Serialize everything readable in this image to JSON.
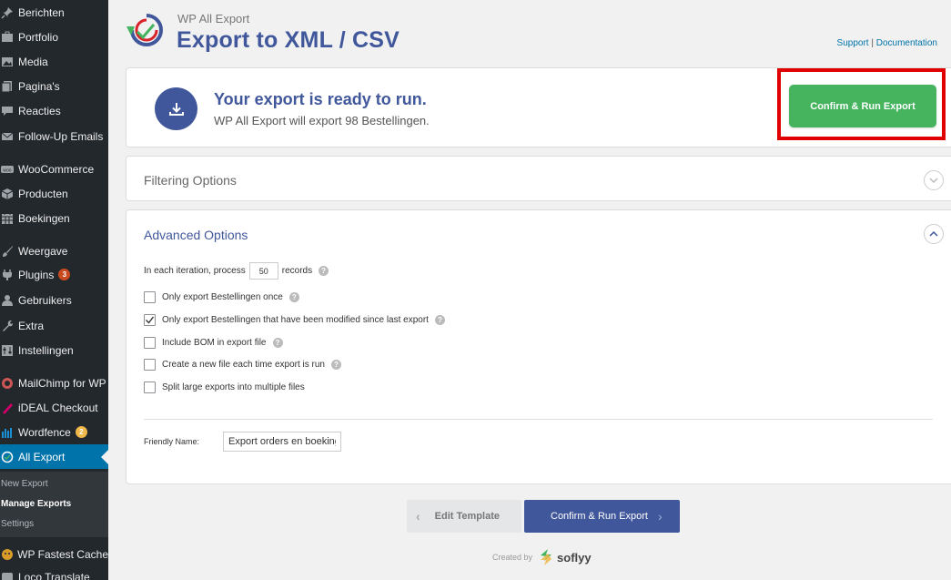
{
  "sidebar": {
    "items": [
      {
        "label": "Berichten",
        "icon": "pin-icon"
      },
      {
        "label": "Portfolio",
        "icon": "portfolio-icon"
      },
      {
        "label": "Media",
        "icon": "media-icon"
      },
      {
        "label": "Pagina's",
        "icon": "pages-icon"
      },
      {
        "label": "Reacties",
        "icon": "comments-icon"
      },
      {
        "label": "Follow-Up Emails",
        "icon": "email-icon"
      },
      {
        "label": "WooCommerce",
        "icon": "woocommerce-icon"
      },
      {
        "label": "Producten",
        "icon": "products-icon"
      },
      {
        "label": "Boekingen",
        "icon": "calendar-icon"
      },
      {
        "label": "Weergave",
        "icon": "brush-icon"
      },
      {
        "label": "Plugins",
        "icon": "plugin-icon",
        "badge": "3",
        "badge_color": "#ca4a1f"
      },
      {
        "label": "Gebruikers",
        "icon": "users-icon"
      },
      {
        "label": "Extra",
        "icon": "wrench-icon"
      },
      {
        "label": "Instellingen",
        "icon": "settings-icon"
      },
      {
        "label": "MailChimp for WP",
        "icon": "mailchimp-icon"
      },
      {
        "label": "iDEAL Checkout",
        "icon": "ideal-icon"
      },
      {
        "label": "Wordfence",
        "icon": "wordfence-icon",
        "badge": "2",
        "badge_color": "#f0b849"
      },
      {
        "label": "All Export",
        "icon": "all-export-icon",
        "active": true
      },
      {
        "label": "WP Fastest Cache",
        "icon": "cheetah-icon"
      },
      {
        "label": "Loco Translate",
        "icon": "translate-icon"
      }
    ],
    "submenu": [
      {
        "label": "New Export"
      },
      {
        "label": "Manage Exports",
        "current": true
      },
      {
        "label": "Settings"
      }
    ]
  },
  "header": {
    "app_name": "WP All Export",
    "title": "Export to XML / CSV",
    "support": "Support",
    "separator": "|",
    "documentation": "Documentation"
  },
  "ready": {
    "title": "Your export is ready to run.",
    "subtitle": "WP All Export will export 98 Bestellingen.",
    "confirm_label": "Confirm & Run Export"
  },
  "filtering": {
    "title": "Filtering Options"
  },
  "advanced": {
    "title": "Advanced Options",
    "iteration_prefix": "In each iteration, process",
    "records_value": "50",
    "iteration_suffix": "records",
    "options": [
      {
        "label": "Only export Bestellingen once",
        "checked": false,
        "help": true
      },
      {
        "label": "Only export Bestellingen that have been modified since last export",
        "checked": true,
        "help": true
      },
      {
        "label": "Include BOM in export file",
        "checked": false,
        "help": true
      },
      {
        "label": "Create a new file each time export is run",
        "checked": false,
        "help": true
      },
      {
        "label": "Split large exports into multiple files",
        "checked": false,
        "help": false
      }
    ],
    "friendly_name_label": "Friendly Name:",
    "friendly_name_value": "Export orders en boekingen"
  },
  "actions": {
    "edit_template": "Edit Template",
    "confirm_run": "Confirm & Run Export"
  },
  "footer": {
    "created_by": "Created by",
    "brand": "soflyy"
  },
  "colors": {
    "brand_blue": "#40579b",
    "wp_blue": "#0073aa",
    "green": "#46b45f",
    "highlight_red": "#e00000",
    "sidebar_bg": "#23282d"
  }
}
